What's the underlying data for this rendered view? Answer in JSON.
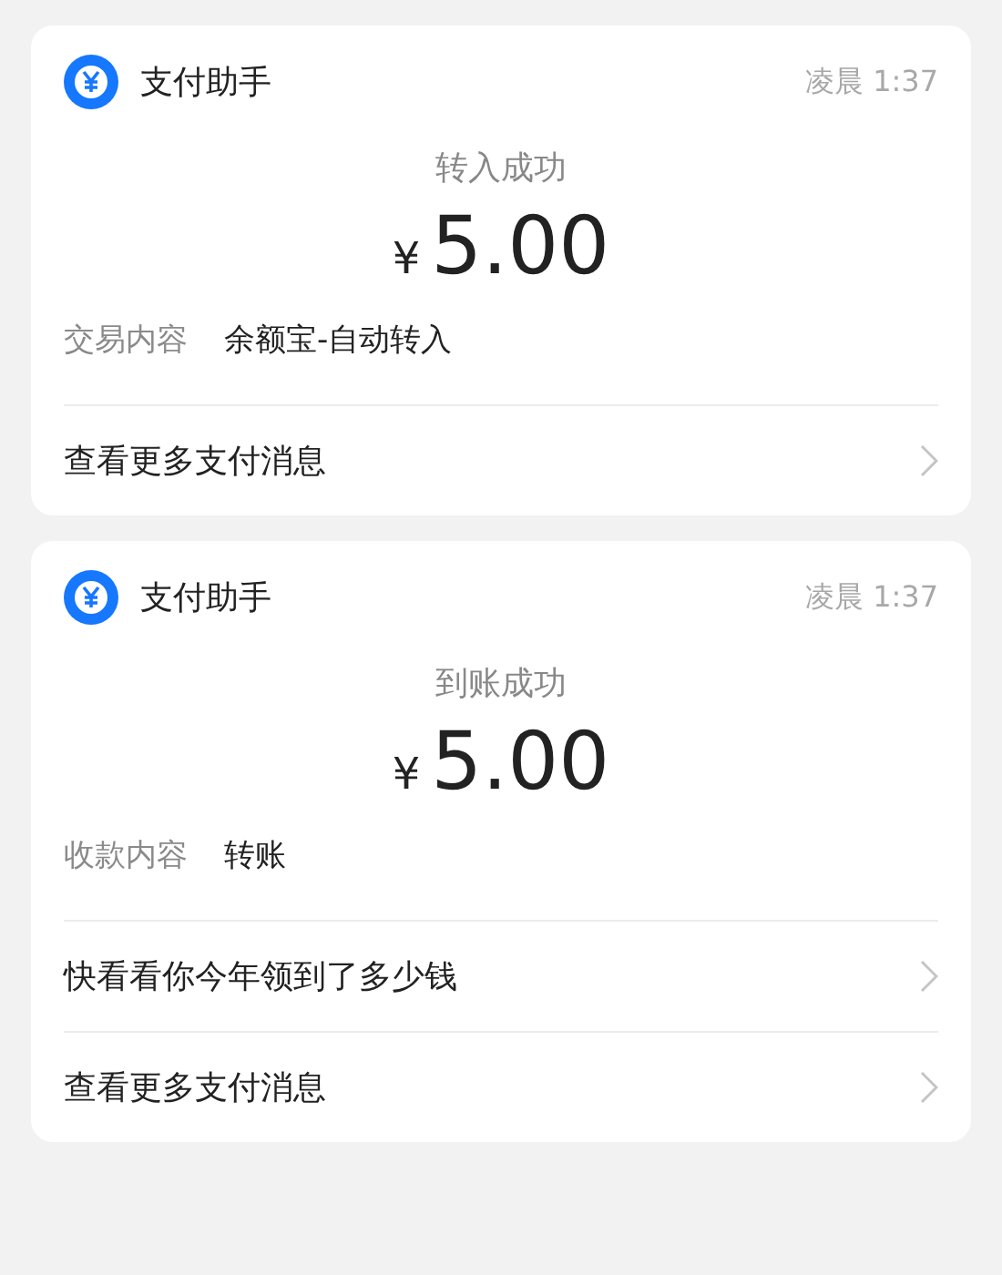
{
  "cards": [
    {
      "app_name": "支付助手",
      "time": "凌晨 1:37",
      "status": "转入成功",
      "currency": "¥",
      "amount": "5.00",
      "detail": {
        "label": "交易内容",
        "value": "余额宝-自动转入"
      },
      "links": [
        "查看更多支付消息"
      ]
    },
    {
      "app_name": "支付助手",
      "time": "凌晨 1:37",
      "status": "到账成功",
      "currency": "¥",
      "amount": "5.00",
      "detail": {
        "label": "收款内容",
        "value": "转账"
      },
      "links": [
        "快看看你今年领到了多少钱",
        "查看更多支付消息"
      ]
    }
  ]
}
